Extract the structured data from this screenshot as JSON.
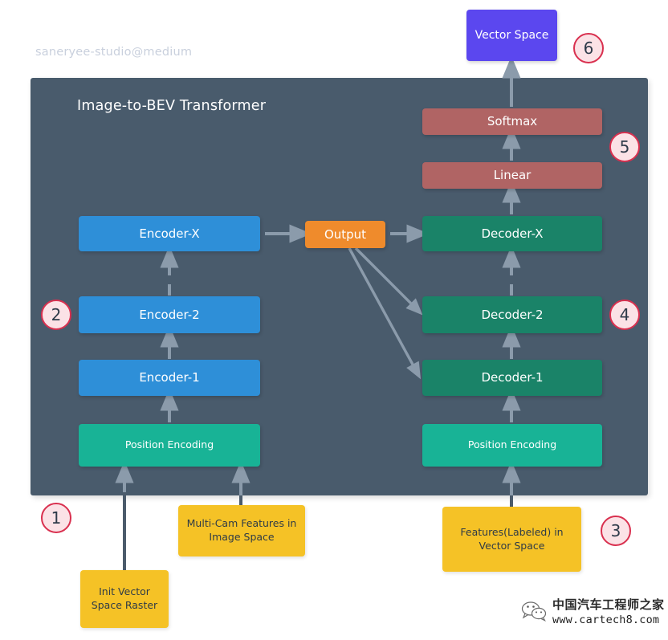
{
  "watermarks": {
    "top_left": "saneryee-studio@medium",
    "bottom_right_cn": "中国汽车工程师之家",
    "bottom_right_url": "www.cartech8.com",
    "wechat_icon": "wechat-icon"
  },
  "panel": {
    "title": "Image-to-BEV Transformer",
    "background_color": "#495b6c"
  },
  "encoder_column": {
    "nodes": [
      {
        "label": "Encoder-X",
        "color": "#2e8fd8"
      },
      {
        "label": "Encoder-2",
        "color": "#2e8fd8"
      },
      {
        "label": "Encoder-1",
        "color": "#2e8fd8"
      },
      {
        "label": "Position Encoding",
        "color": "#18b396"
      }
    ]
  },
  "decoder_column": {
    "nodes": [
      {
        "label": "Decoder-X",
        "color": "#1a8368"
      },
      {
        "label": "Decoder-2",
        "color": "#1a8368"
      },
      {
        "label": "Decoder-1",
        "color": "#1a8368"
      },
      {
        "label": "Position Encoding",
        "color": "#18b396"
      }
    ]
  },
  "head_column": {
    "nodes": [
      {
        "label": "Softmax",
        "color": "#b06464"
      },
      {
        "label": "Linear",
        "color": "#b06464"
      }
    ]
  },
  "bridge": {
    "label": "Output",
    "color": "#ef8b2c"
  },
  "outputs": {
    "vector_space": {
      "label": "Vector Space",
      "color": "#5b47ef"
    }
  },
  "inputs": [
    {
      "label": "Init Vector\nSpace Raster",
      "line1": "Init Vector",
      "line2": "Space Raster",
      "color": "#f5c226"
    },
    {
      "label": "Multi-Cam Features in\nImage Space",
      "line1": "Multi-Cam Features in",
      "line2": "Image Space",
      "color": "#f5c226"
    },
    {
      "label": "Features(Labeled) in\nVector Space",
      "line1": "Features(Labeled) in",
      "line2": "Vector Space",
      "color": "#f5c226"
    }
  ],
  "markers": [
    {
      "number": "1"
    },
    {
      "number": "2"
    },
    {
      "number": "3"
    },
    {
      "number": "4"
    },
    {
      "number": "5"
    },
    {
      "number": "6"
    }
  ],
  "colors": {
    "arrow": "#8b9bab",
    "marker_fill": "#fbe2e6",
    "marker_border": "#d9304f",
    "panel": "#495b6c",
    "dark_line": "#4b5b6b"
  }
}
